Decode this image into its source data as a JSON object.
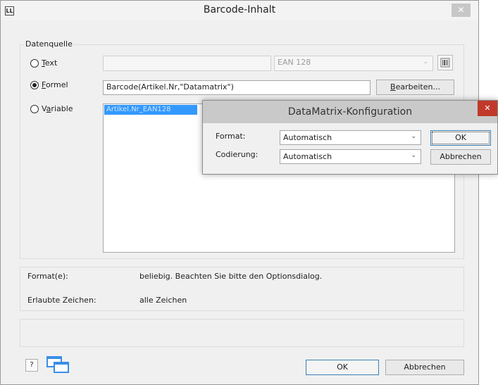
{
  "window": {
    "title": "Barcode-Inhalt",
    "icon_text": "LL",
    "close": "✕"
  },
  "datasource": {
    "group_label": "Datenquelle",
    "text_option": {
      "label": "Text",
      "selected": false,
      "value": "",
      "type": "EAN 128"
    },
    "formula_option": {
      "label": "Formel",
      "selected": true,
      "value": "Barcode(Artikel.Nr,\"Datamatrix\")",
      "edit_button": "Bearbeiten..."
    },
    "variable_option": {
      "label": "Variable",
      "selected": false,
      "list_items": [
        "Artikel.Nr_EAN128"
      ]
    }
  },
  "info": {
    "format_label": "Format(e):",
    "format_value": "beliebig. Beachten Sie bitte den Optionsdialog.",
    "chars_label": "Erlaubte Zeichen:",
    "chars_value": "alle Zeichen"
  },
  "footer": {
    "ok": "OK",
    "cancel": "Abbrechen",
    "help_icon": "?"
  },
  "datamatrix_dialog": {
    "title": "DataMatrix-Konfiguration",
    "close": "✕",
    "format_label": "Format:",
    "format_value": "Automatisch",
    "encoding_label": "Codierung:",
    "encoding_value": "Automatisch",
    "ok": "OK",
    "cancel": "Abbrechen"
  }
}
